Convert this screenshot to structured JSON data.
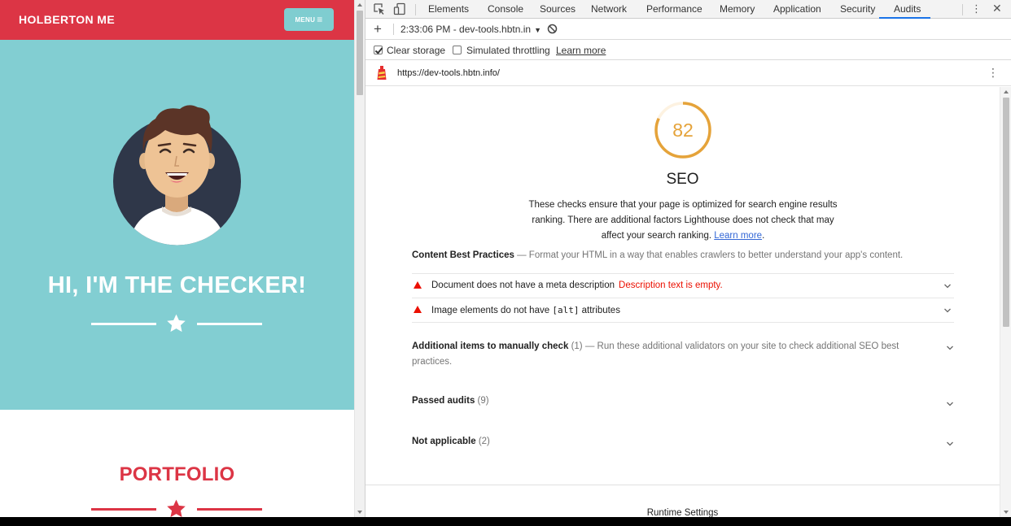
{
  "site": {
    "brand": "HOLBERTON ME",
    "menu_label": "MENU",
    "menu_icon": "hamburger-icon",
    "hero_title": "HI, I'M THE CHECKER!",
    "portfolio_title": "PORTFOLIO",
    "colors": {
      "primary": "#dc3545",
      "hero_bg": "#82ced2",
      "menu_bg": "#7fcdd0"
    }
  },
  "devtools": {
    "tabs": [
      "Elements",
      "Console",
      "Sources",
      "Network",
      "Performance",
      "Memory",
      "Application",
      "Security",
      "Audits"
    ],
    "active_tab": "Audits",
    "run_selector": "2:33:06 PM - dev-tools.hbtn.in",
    "clear_storage_label": "Clear storage",
    "clear_storage_checked": true,
    "throttling_label": "Simulated throttling",
    "throttling_checked": false,
    "learn_more_link": "Learn more",
    "url": "https://dev-tools.hbtn.info/"
  },
  "report": {
    "score": "82",
    "score_fraction": 0.82,
    "score_color": "#e5a33a",
    "category_title": "SEO",
    "description": "These checks ensure that your page is optimized for search engine results ranking. There are additional factors Lighthouse does not check that may affect your search ranking.",
    "description_link": "Learn more",
    "content_group": {
      "title": "Content Best Practices",
      "desc": "Format your HTML in a way that enables crawlers to better understand your app's content."
    },
    "failing_audits": [
      {
        "title": "Document does not have a meta description",
        "error": "Description text is empty."
      },
      {
        "title_pre": "Image elements do not have ",
        "code": "[alt]",
        "title_post": " attributes"
      }
    ],
    "manual_group": {
      "title": "Additional items to manually check",
      "count": "(1)",
      "desc": "Run these additional validators on your site to check additional SEO best practices."
    },
    "passed_group": {
      "title": "Passed audits",
      "count": "(9)"
    },
    "na_group": {
      "title": "Not applicable",
      "count": "(2)"
    },
    "runtime_settings": "Runtime Settings"
  }
}
